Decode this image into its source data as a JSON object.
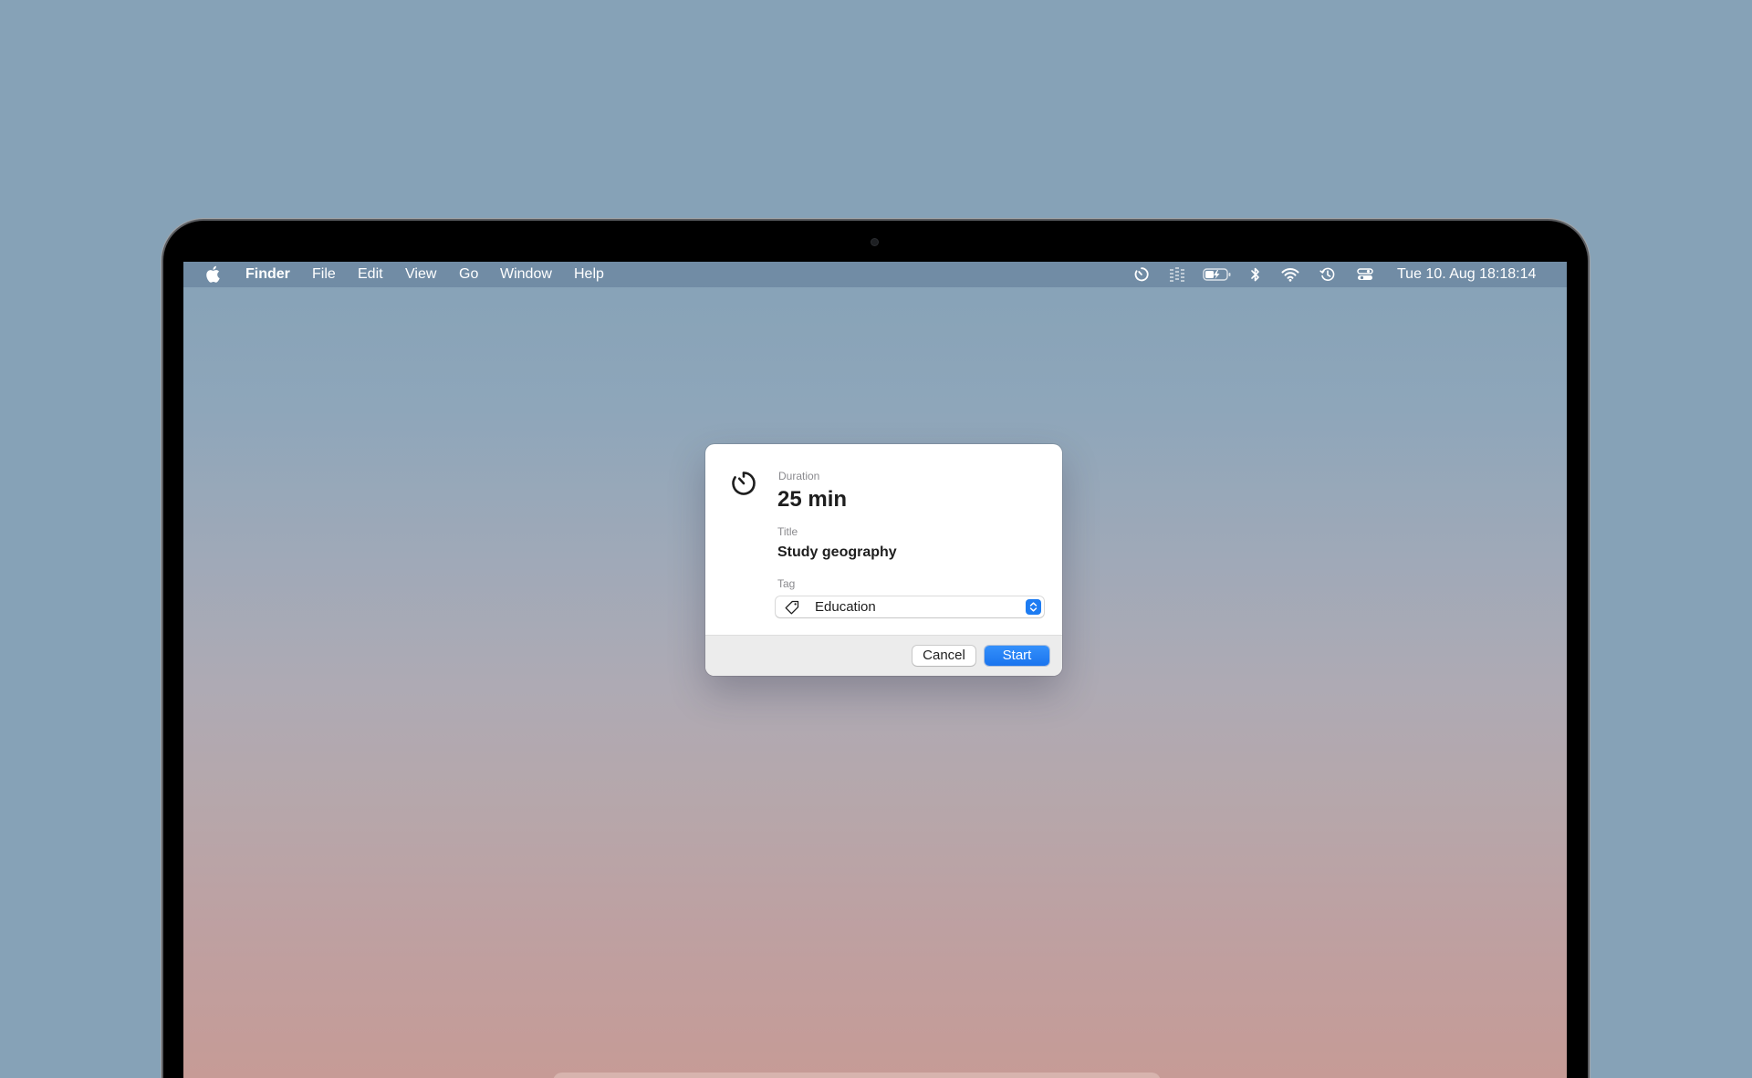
{
  "menubar": {
    "apple_icon": "apple-logo-icon",
    "app_name": "Finder",
    "menus": [
      "File",
      "Edit",
      "View",
      "Go",
      "Window",
      "Help"
    ],
    "status_icons": [
      "timer-icon",
      "sound-bars-icon",
      "battery-charging-icon",
      "bluetooth-icon",
      "wifi-icon",
      "time-machine-icon",
      "control-center-icon"
    ],
    "clock": "Tue 10. Aug  18:18:14"
  },
  "dialog": {
    "icon": "timer-icon",
    "duration_label": "Duration",
    "duration_value": "25 min",
    "title_label": "Title",
    "title_value": "Study geography",
    "tag_label": "Tag",
    "tag_icon": "tag-icon",
    "tag_value": "Education",
    "cancel_label": "Cancel",
    "start_label": "Start"
  },
  "colors": {
    "accent": "#1d7cf2",
    "background": "#86a2b7"
  }
}
